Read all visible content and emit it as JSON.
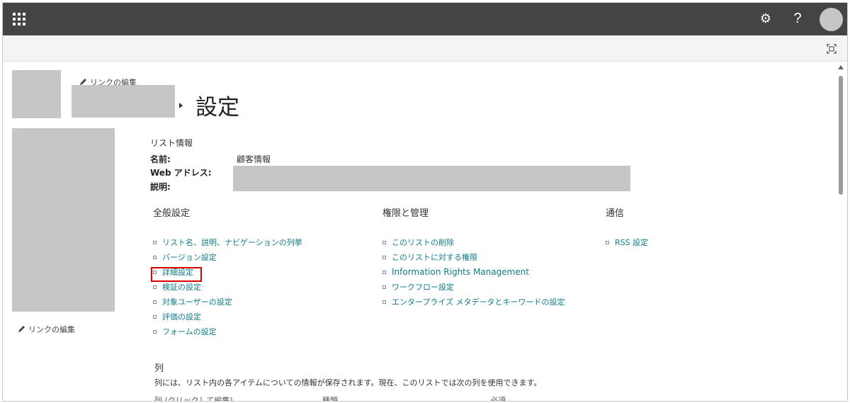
{
  "topbar": {
    "app_launcher_icon": "waffle-icon",
    "settings_icon": "gear-icon",
    "help_label": "?",
    "avatar_icon": "avatar"
  },
  "subbar": {
    "focus_icon": "focus-mode-icon"
  },
  "left_nav": {
    "edit_links_label": "リンクの編集"
  },
  "header": {
    "edit_links_label": "リンクの編集",
    "page_title": "設定"
  },
  "list_info": {
    "section_label": "リスト情報",
    "name_label": "名前:",
    "name_value": "顧客情報",
    "web_address_label": "Web アドレス:",
    "description_label": "説明:"
  },
  "general_settings": {
    "heading": "全般設定",
    "links": [
      "リスト名、説明、ナビゲーションの列挙",
      "バージョン設定",
      "詳細設定",
      "検証の設定",
      "対象ユーザーの設定",
      "評価の設定",
      "フォームの設定"
    ]
  },
  "permissions": {
    "heading": "権限と管理",
    "links": [
      "このリストの削除",
      "このリストに対する権限",
      "Information Rights Management",
      "ワークフロー設定",
      "エンタープライズ メタデータとキーワードの設定"
    ]
  },
  "communications": {
    "heading": "通信",
    "links": [
      "RSS 設定"
    ]
  },
  "columns": {
    "title": "列",
    "description": "列には、リスト内の各アイテムについての情報が保存されます。現在、このリストでは次の列を使用できます。",
    "table_headers": [
      "列 (クリックして編集)",
      "種類",
      "必須"
    ]
  },
  "colors": {
    "topbar": "#464343",
    "link": "#0f7c8a",
    "highlight": "#e00000"
  }
}
